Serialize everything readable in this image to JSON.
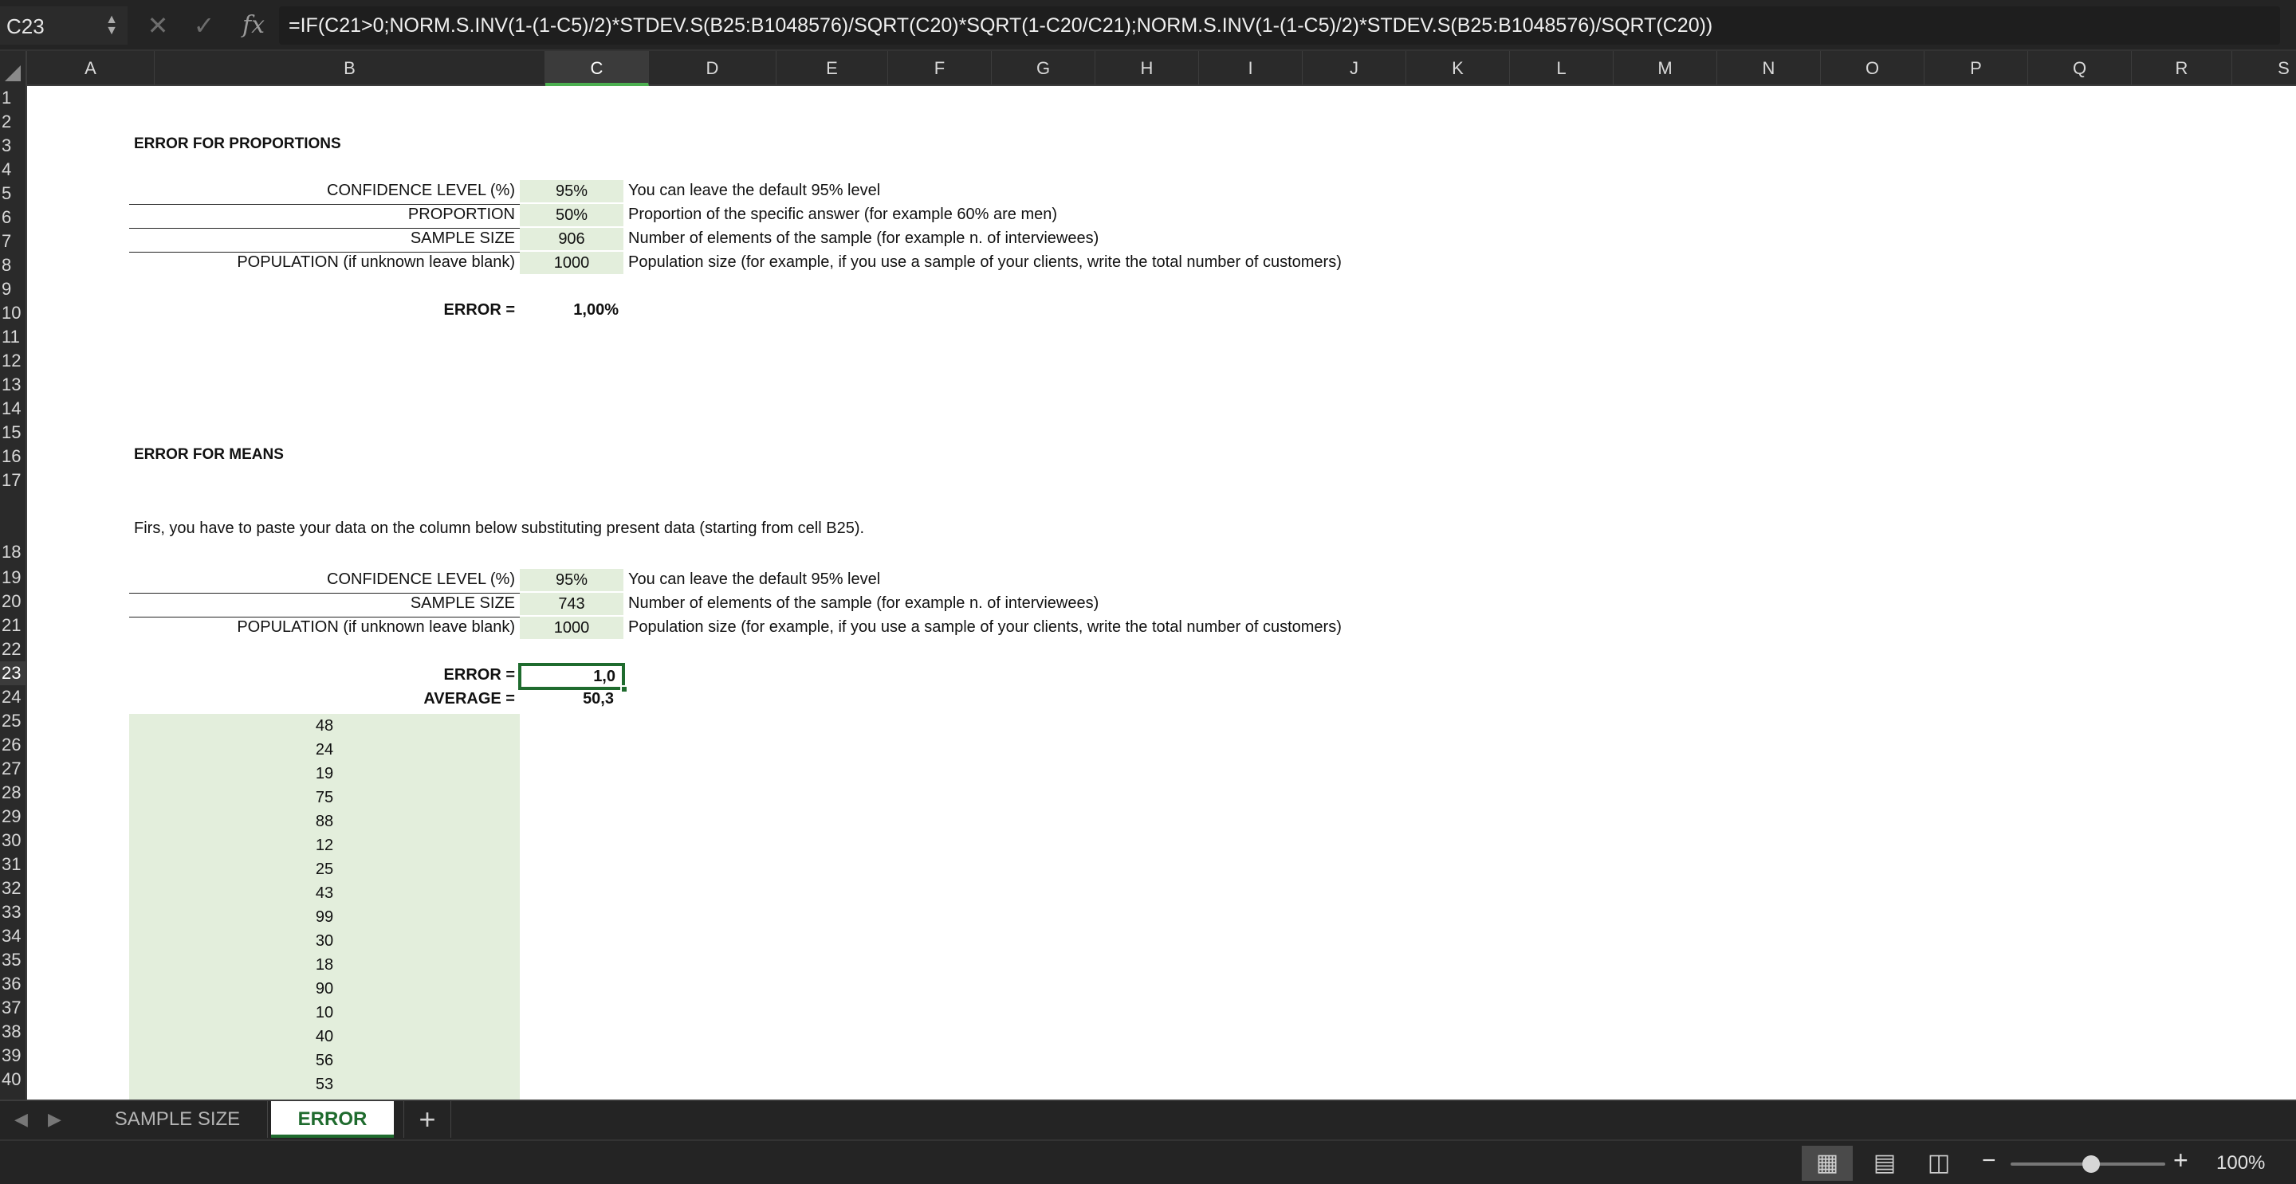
{
  "formula_bar": {
    "name_box": "C23",
    "fx_label": "fx",
    "cancel_glyph": "✕",
    "confirm_glyph": "✓",
    "formula": "=IF(C21>0;NORM.S.INV(1-(1-C5)/2)*STDEV.S(B25:B1048576)/SQRT(C20)*SQRT(1-C20/C21);NORM.S.INV(1-(1-C5)/2)*STDEV.S(B25:B1048576)/SQRT(C20))"
  },
  "columns": [
    "A",
    "B",
    "C",
    "D",
    "E",
    "F",
    "G",
    "H",
    "I",
    "J",
    "K",
    "L",
    "M",
    "N",
    "O",
    "P",
    "Q",
    "R",
    "S"
  ],
  "selected_column": "C",
  "rows": [
    "1",
    "2",
    "3",
    "4",
    "5",
    "6",
    "7",
    "8",
    "9",
    "10",
    "11",
    "12",
    "13",
    "14",
    "15",
    "16",
    "17",
    "18",
    "19",
    "20",
    "21",
    "22",
    "23",
    "24",
    "25",
    "26",
    "27",
    "28",
    "29",
    "30",
    "31",
    "32",
    "33",
    "34",
    "35",
    "36",
    "37",
    "38",
    "39",
    "40"
  ],
  "selected_row": "23",
  "proportions": {
    "title": "ERROR FOR PROPORTIONS",
    "confidence_label": "CONFIDENCE LEVEL (%)",
    "confidence_value": "95%",
    "confidence_note": "You can leave the default 95% level",
    "proportion_label": "PROPORTION",
    "proportion_value": "50%",
    "proportion_note": "Proportion of the specific answer (for example 60% are men)",
    "sample_label": "SAMPLE SIZE",
    "sample_value": "906",
    "sample_note": "Number of elements of the sample (for example n. of interviewees)",
    "population_label": "POPULATION (if unknown leave blank)",
    "population_value": "1000",
    "population_note": "Population size (for example, if you use a sample of your clients, write the total number of customers)",
    "error_label": "ERROR =",
    "error_value": "1,00%"
  },
  "means": {
    "title": "ERROR FOR MEANS",
    "instructions": "Firs, you have to paste your data on the column below substituting present data (starting from cell B25).",
    "confidence_label": "CONFIDENCE LEVEL (%)",
    "confidence_value": "95%",
    "confidence_note": "You can leave the default 95% level",
    "sample_label": "SAMPLE SIZE",
    "sample_value": "743",
    "sample_note": "Number of elements of the sample (for example n. of interviewees)",
    "population_label": "POPULATION (if unknown leave blank)",
    "population_value": "1000",
    "population_note": "Population size (for example, if you use a sample of your clients, write the total number of customers)",
    "error_label": "ERROR =",
    "error_value": "1,0",
    "average_label": "AVERAGE =",
    "average_value": "50,3",
    "data": [
      "48",
      "24",
      "19",
      "75",
      "88",
      "12",
      "25",
      "43",
      "99",
      "30",
      "18",
      "90",
      "10",
      "40",
      "56",
      "53"
    ]
  },
  "tabs": {
    "prev": "◀",
    "next": "▶",
    "sheet1": "SAMPLE SIZE",
    "sheet2": "ERROR",
    "add": "+"
  },
  "status": {
    "zoom_minus": "−",
    "zoom_plus": "+",
    "zoom_level": "100%",
    "zoom_fraction": 0.52
  },
  "colors": {
    "accent": "#1f6b2e",
    "input_fill": "#e3eedc"
  }
}
